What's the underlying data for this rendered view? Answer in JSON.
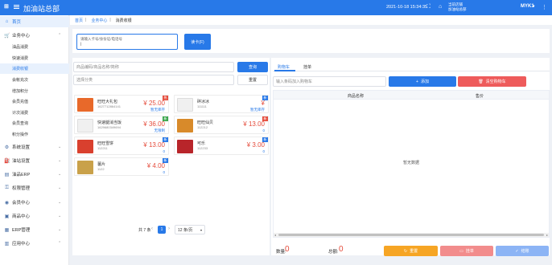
{
  "header": {
    "app_title": "加油站总部",
    "datetime": "2021-10-18 15:34:35",
    "store_line1": "当前店铺",
    "store_line2": "加油站总部",
    "username": "MYK1",
    "colors": {
      "topbar": "#2879e8"
    }
  },
  "sidebar": {
    "home": "首页",
    "business_center": "业务中心",
    "sub_items": [
      "油品消费",
      "快速消费",
      "消费收银",
      "会帐充次",
      "增加积分",
      "会员充值",
      "计次消费",
      "会员查询",
      "积分操作"
    ],
    "groups": [
      "系统设置",
      "油站设置",
      "油品ERP",
      "权限管理",
      "会员中心",
      "商品中心",
      "ERP管理",
      "应用中心"
    ]
  },
  "breadcrumb": {
    "home": "首页",
    "business": "业务中心",
    "current": "消费收银"
  },
  "member": {
    "placeholder": "请输入卡号/身份证/电话号",
    "read_card": "读卡(F)"
  },
  "products_panel": {
    "search_placeholder": "商品编码/商品名称/简称",
    "search_button": "查询",
    "category_placeholder": "选择分类",
    "reset_button": "重置",
    "items": [
      {
        "name": "旺旺大礼包",
        "code": "1627712864141",
        "price": "¥ 25.00",
        "stock": "暂无库存",
        "badge": "热",
        "badge_color": "#e54c3c",
        "thumb_color": "#e8692a"
      },
      {
        "name": "碎冰冰",
        "code": "111111",
        "price": "¥",
        "stock": "暂无库存",
        "badge": "新",
        "badge_color": "#2879e8",
        "thumb_color": "#f0f0f0"
      },
      {
        "name": "快速腿消当饭",
        "code": "1629680349694",
        "price": "¥ 36.00",
        "stock": "无限制",
        "badge": "新",
        "badge_color": "#3aa64c",
        "thumb_color": "#f0f0f0"
      },
      {
        "name": "旺旺仙贝",
        "code": "112212",
        "price": "¥ 13.00",
        "stock": "0",
        "badge": "新",
        "badge_color": "#e54c3c",
        "thumb_color": "#d88a2a"
      },
      {
        "name": "旺旺雪饼",
        "code": "112211",
        "price": "¥ 13.00",
        "stock": "0",
        "badge": "新",
        "badge_color": "#2879e8",
        "thumb_color": "#d9402e"
      },
      {
        "name": "可乐",
        "code": "112233",
        "price": "¥ 3.00",
        "stock": "0",
        "badge": "新",
        "badge_color": "#2879e8",
        "thumb_color": "#b8252a"
      },
      {
        "name": "薯片",
        "code": "1122",
        "price": "¥ 4.00",
        "stock": "0",
        "badge": "新",
        "badge_color": "#2879e8",
        "thumb_color": "#c9a14a"
      }
    ],
    "pagination": {
      "total": "共 7 条",
      "page": "1",
      "page_size": "12 条/页"
    }
  },
  "cart_panel": {
    "tabs": [
      "购物车",
      "挂单"
    ],
    "barcode_placeholder": "输入条码加入购物车",
    "add_button": "添加",
    "clear_button": "清空购物车",
    "columns": [
      "商品名称",
      "售价"
    ],
    "empty_text": "暂无数据",
    "qty_label": "数量:",
    "qty_value": "0",
    "total_label": "总额:",
    "total_value": "0",
    "reset_button": "重置",
    "hold_button": "挂单",
    "checkout_button": "结账"
  }
}
